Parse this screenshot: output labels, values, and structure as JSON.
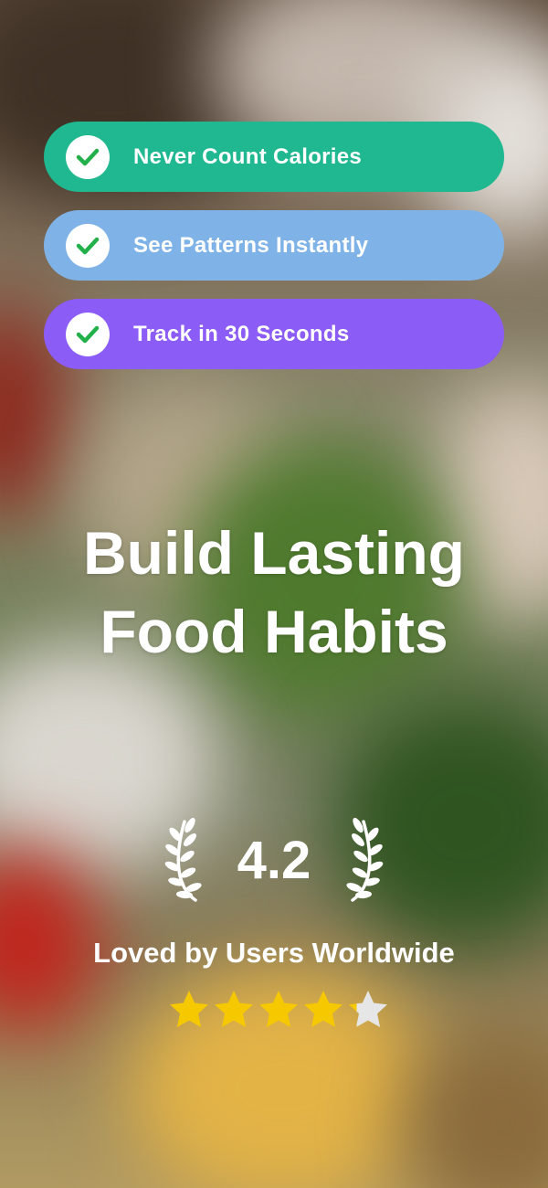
{
  "features": [
    {
      "label": "Never Count Calories",
      "color": "#1fb890",
      "icon": "checkmark-icon"
    },
    {
      "label": "See Patterns Instantly",
      "color": "#7fb3e8",
      "icon": "checkmark-icon"
    },
    {
      "label": "Track in 30 Seconds",
      "color": "#8b5cf6",
      "icon": "checkmark-icon"
    }
  ],
  "headline": {
    "line1": "Build Lasting",
    "line2": "Food Habits"
  },
  "rating": {
    "value": "4.2",
    "score": 4.2,
    "max": 5,
    "tagline": "Loved by Users Worldwide",
    "star_color": "#f5c800",
    "empty_star_color": "#e6e6e6",
    "laurel_icon": "laurel-wreath-icon",
    "star_icon": "star-icon"
  },
  "colors": {
    "check": "#22b04a"
  }
}
